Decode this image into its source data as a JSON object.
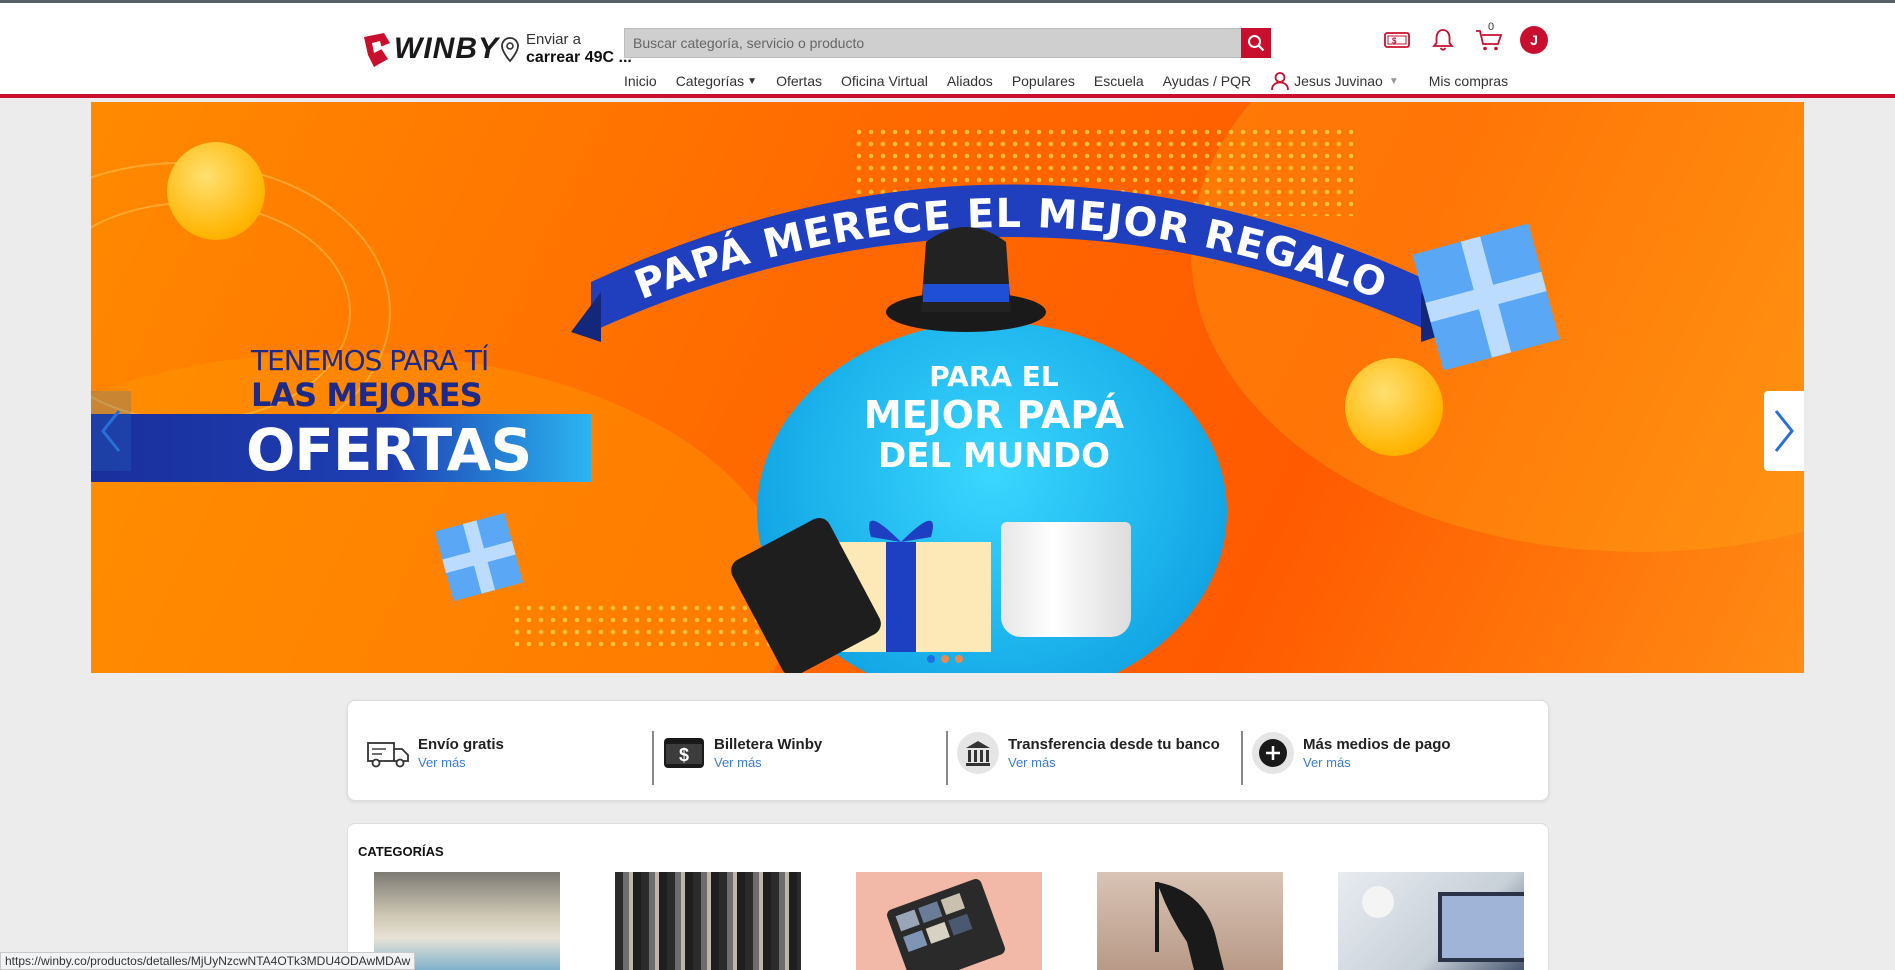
{
  "header": {
    "logo_text": "WINBY",
    "ship_label": "Enviar a",
    "ship_address": "carrear 49C ...",
    "search_placeholder": "Buscar categoría, servicio o producto",
    "cart_count": "0",
    "avatar_initial": "J"
  },
  "nav": {
    "items": [
      "Inicio",
      "Categorías",
      "Ofertas",
      "Oficina Virtual",
      "Aliados",
      "Populares",
      "Escuela",
      "Ayudas / PQR"
    ],
    "user_name": "Jesus Juvinao",
    "purchases": "Mis compras"
  },
  "banner": {
    "ribbon_text": "PAPÁ MERECE EL MEJOR REGALO",
    "offer_line1": "TENEMOS PARA TÍ",
    "offer_line2": "LAS MEJORES",
    "offer_line3": "OFERTAS",
    "bubble_line1": "PARA EL",
    "bubble_line2": "MEJOR PAPÁ",
    "bubble_line3": "DEL MUNDO",
    "slides": 3,
    "active_slide": 1
  },
  "payments": {
    "items": [
      {
        "title": "Envío gratis",
        "link": "Ver más",
        "icon": "truck-icon"
      },
      {
        "title": "Billetera Winby",
        "link": "Ver más",
        "icon": "wallet-icon"
      },
      {
        "title": "Transferencia desde tu banco",
        "link": "Ver más",
        "icon": "bank-icon"
      },
      {
        "title": "Más medios de pago",
        "link": "Ver más",
        "icon": "plus-circle-icon"
      }
    ]
  },
  "categories": {
    "title": "CATEGORÍAS"
  },
  "status_bar": {
    "url": "https://winby.co/productos/detalles/MjUyNzcwNTA4OTk3MDU4ODAwMDAw"
  },
  "colors": {
    "brand_red": "#c8102e",
    "link_blue": "#3b7bd8",
    "banner_orange": "#ff6a00",
    "banner_blue": "#1d2a8a"
  }
}
